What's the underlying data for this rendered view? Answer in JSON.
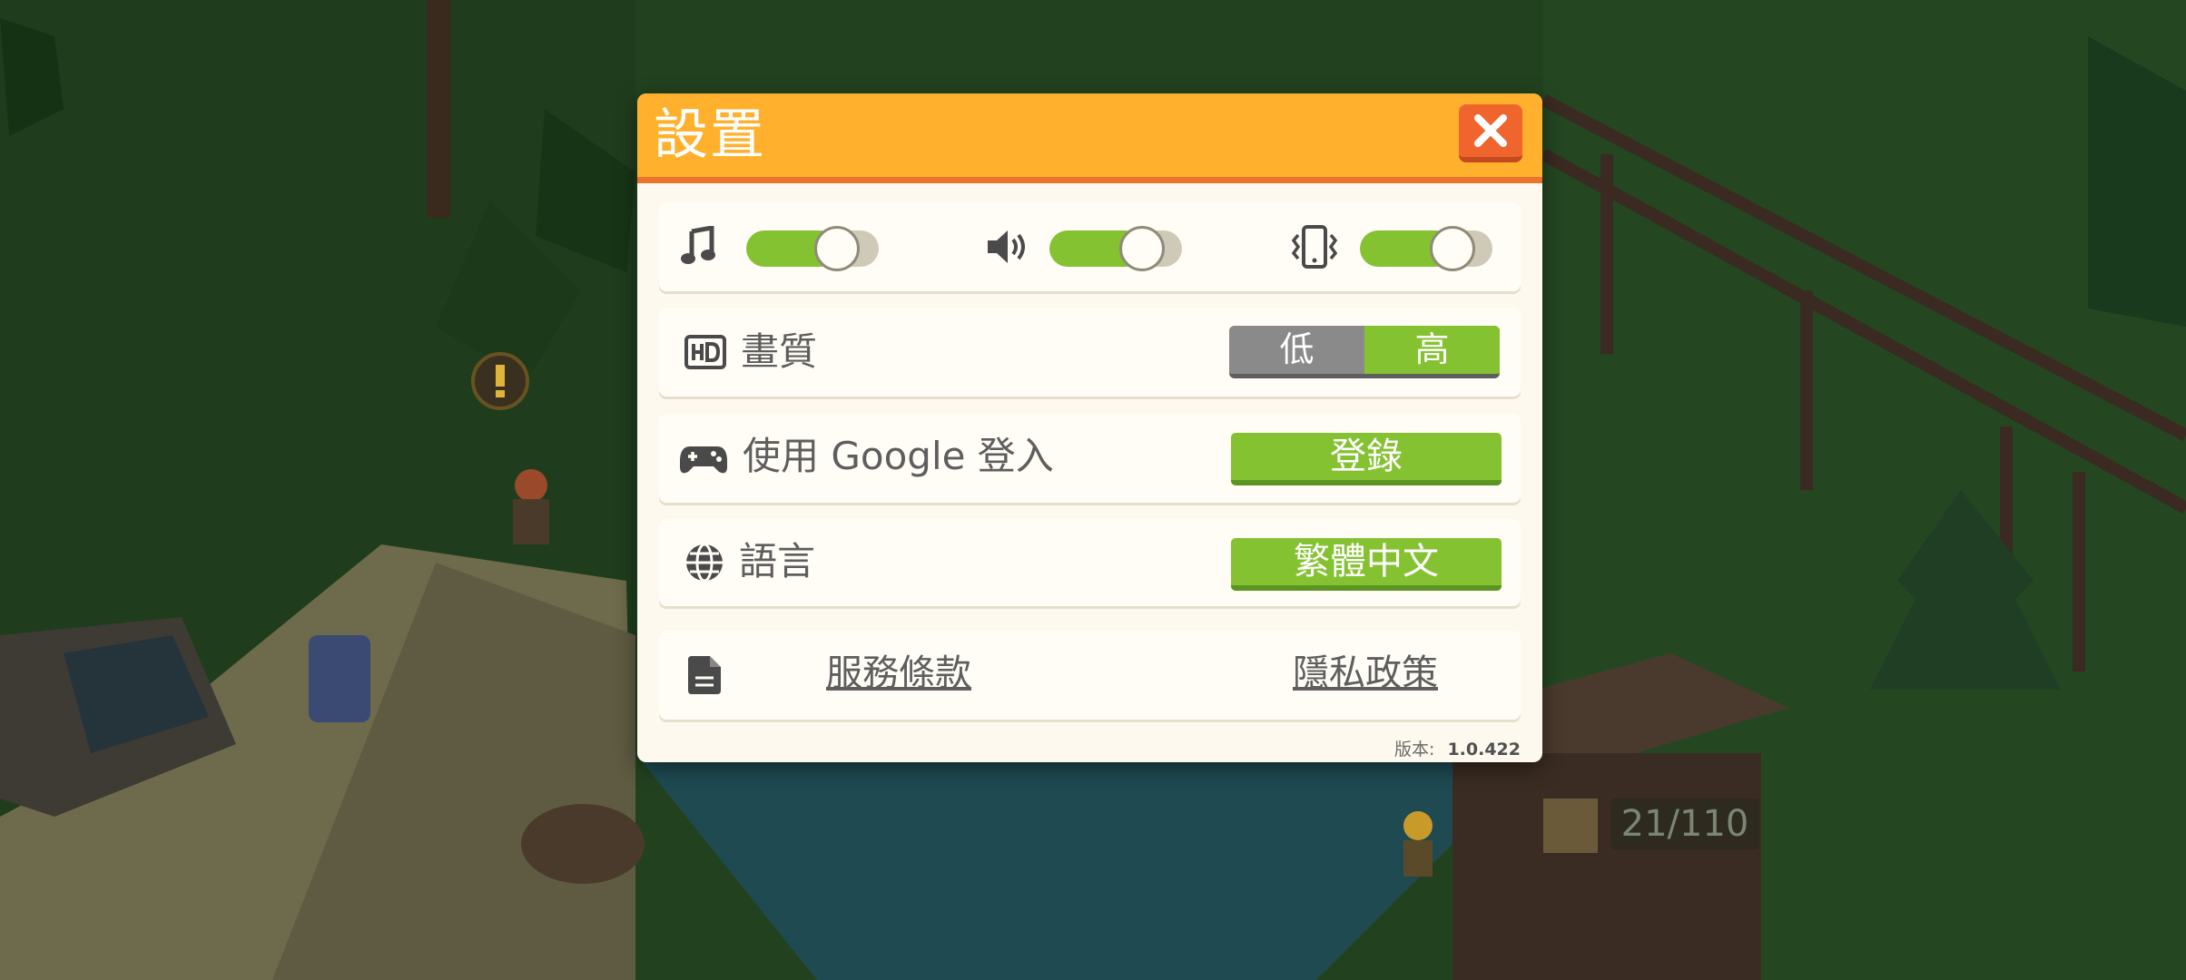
{
  "dialog": {
    "title": "設置",
    "close_icon": "close-x-icon",
    "accent_color": "#ffb12e",
    "audio": {
      "music": {
        "icon": "music-note-icon",
        "level": 0.78
      },
      "sound": {
        "icon": "speaker-icon",
        "level": 0.8
      },
      "vibration": {
        "icon": "vibration-phone-icon",
        "level": 0.8
      }
    },
    "quality": {
      "icon": "hd-icon",
      "label": "畫質",
      "low": "低",
      "high": "高",
      "selected": "高"
    },
    "google": {
      "icon": "gamepad-icon",
      "label": "使用 Google 登入",
      "button": "登錄"
    },
    "language": {
      "icon": "globe-icon",
      "label": "語言",
      "button": "繁體中文"
    },
    "legal": {
      "icon": "document-icon",
      "terms": "服務條款",
      "privacy": "隱私政策"
    },
    "version_label": "版本:",
    "version_value": "1.0.422"
  },
  "hud": {
    "counter": "21/110",
    "alert_icon": "exclamation-marker-icon"
  }
}
